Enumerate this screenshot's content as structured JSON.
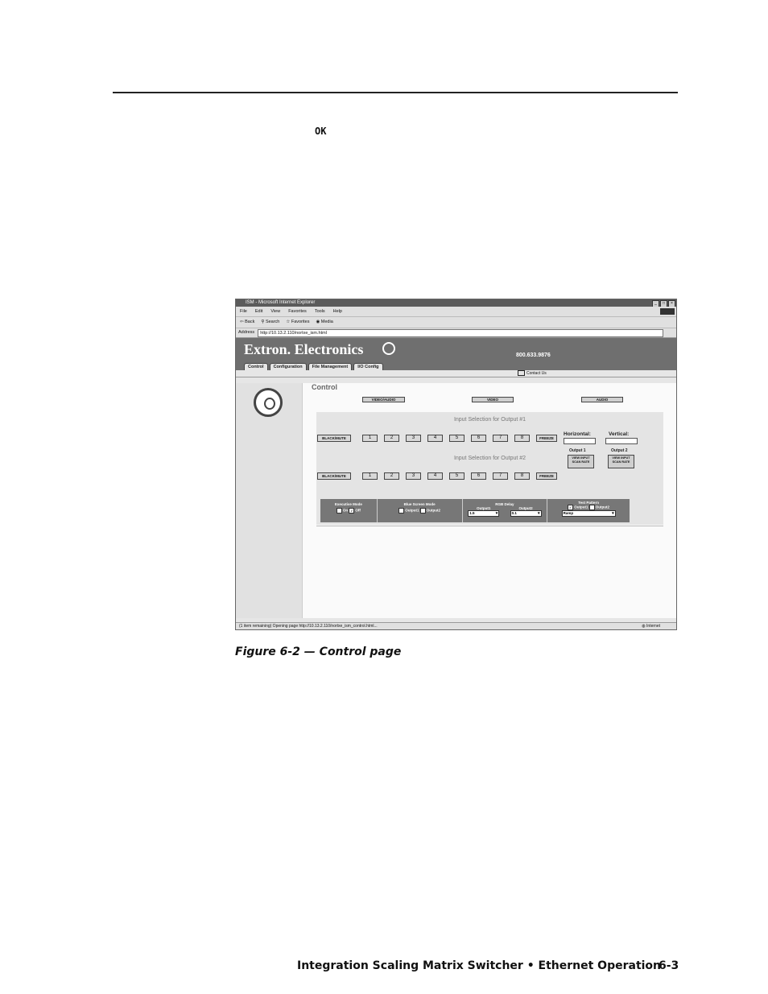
{
  "ok_text": "OK",
  "browser": {
    "title": "ISM - Microsoft Internet Explorer",
    "menu": [
      "File",
      "Edit",
      "View",
      "Favorites",
      "Tools",
      "Help"
    ],
    "toolbar": [
      "Back",
      "Search",
      "Favorites",
      "Media"
    ],
    "address_label": "Address",
    "address": "http://10.13.2.110/nortxe_ism.html",
    "status": "(1 item remaining) Opening page http://10.13.2.110/nortxe_ism_control.html...",
    "zone": "Internet"
  },
  "site": {
    "brand": "Extron. Electronics",
    "phone": "800.633.9876",
    "tabs": [
      "Control",
      "Configuration",
      "File Management",
      "I/O Config"
    ],
    "contact": "Contact Us",
    "section_title": "Control",
    "mode_buttons": [
      "VIDEO/AUDIO",
      "VIDEO",
      "AUDIO"
    ],
    "output1_title": "Input Selection for Output #1",
    "output2_title": "Input Selection for Output #2",
    "blackmute": "BLACK/MUTE",
    "inputs": [
      "1",
      "2",
      "3",
      "4",
      "5",
      "6",
      "7",
      "8"
    ],
    "freeze": "FREEZE",
    "horizontal": "Horizontal:",
    "vertical": "Vertical:",
    "output1": "Output 1",
    "output2": "Output 2",
    "scan_btn": "VIEW INPUT SCAN RATE",
    "executive_mode": "Executive Mode",
    "on": "On",
    "off": "Off",
    "blue_screen": "Blue Screen Mode",
    "output1_short": "Output1",
    "output2_short": "Output2",
    "rgb_delay": "RGB Delay",
    "rgb_val1": "1.5",
    "rgb_val2": "0.1",
    "test_pattern": "Test Pattern",
    "pattern_val": "Ramp"
  },
  "caption": "Figure 6-2 — Control page",
  "footer": "Integration Scaling Matrix Switcher • Ethernet Operation",
  "page_number": "6-3"
}
